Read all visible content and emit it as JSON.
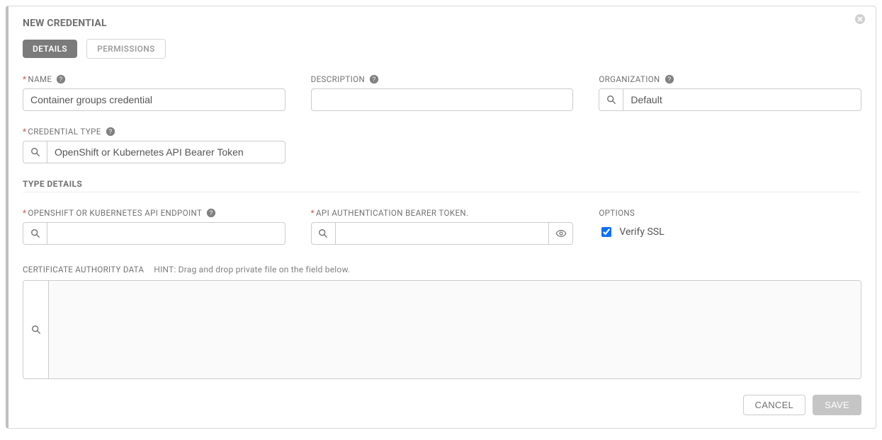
{
  "title": "NEW CREDENTIAL",
  "tabs": {
    "details": "DETAILS",
    "permissions": "PERMISSIONS"
  },
  "fields": {
    "name": {
      "label": "NAME",
      "value": "Container groups credential"
    },
    "description": {
      "label": "DESCRIPTION",
      "value": ""
    },
    "organization": {
      "label": "ORGANIZATION",
      "value": "Default"
    },
    "credential_type": {
      "label": "CREDENTIAL TYPE",
      "value": "OpenShift or Kubernetes API Bearer Token"
    }
  },
  "type_details": {
    "header": "TYPE DETAILS",
    "api_endpoint": {
      "label": "OPENSHIFT OR KUBERNETES API ENDPOINT",
      "value": ""
    },
    "bearer_token": {
      "label": "API AUTHENTICATION BEARER TOKEN.",
      "value": ""
    },
    "options_label": "OPTIONS",
    "verify_ssl": {
      "label": "Verify SSL",
      "checked": true
    },
    "ca_data": {
      "label": "CERTIFICATE AUTHORITY DATA",
      "hint": "HINT: Drag and drop private file on the field below.",
      "value": ""
    }
  },
  "buttons": {
    "cancel": "CANCEL",
    "save": "SAVE"
  }
}
